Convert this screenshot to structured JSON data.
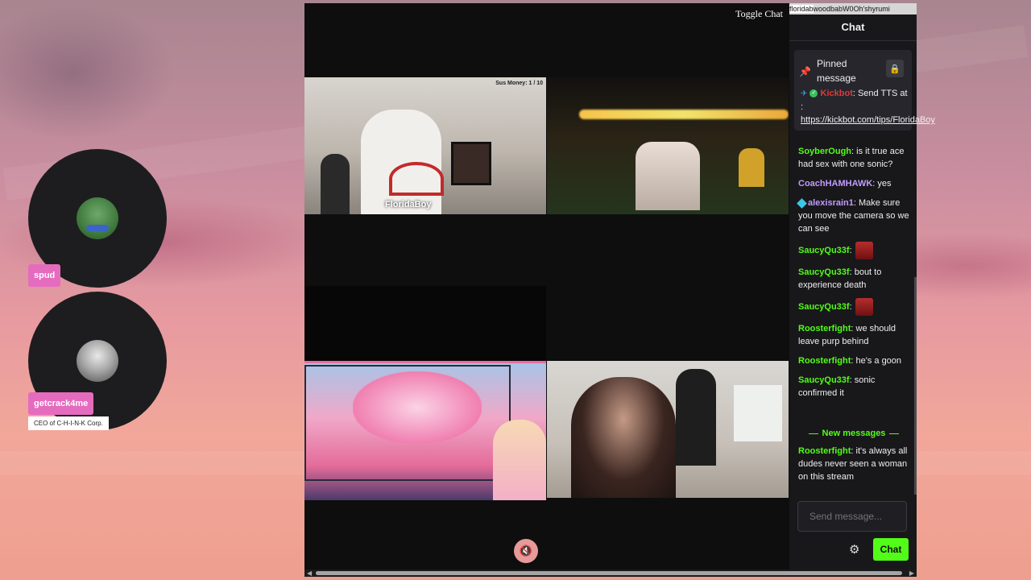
{
  "voice_users": [
    {
      "name": "spud",
      "avatar": "pepe-frog"
    },
    {
      "name": "getcrack4me",
      "subtitle": "CEO of C-H-I-N-K Corp.",
      "avatar": "woman-portrait"
    }
  ],
  "stream": {
    "toggle_chat": "Toggle Chat",
    "tiles": [
      {
        "label": "FloridaBoy",
        "overlay": "Sus Money: 1 / 10"
      },
      {
        "label": ""
      },
      {
        "label": ""
      },
      {
        "label": ""
      }
    ]
  },
  "url_strip": {
    "selected": "floridab",
    "rest": "woodbabW0Oh'shyrumi"
  },
  "chat": {
    "title": "Chat",
    "pinned": {
      "title": "Pinned message",
      "user": "Kickbot",
      "text": ": Send TTS at : ",
      "link": "https://kickbot.com/tips/FloridaBoy"
    },
    "messages": [
      {
        "user": "SoyberOugh",
        "color": "#53fc18",
        "text": ": is it true ace had sex with one sonic?"
      },
      {
        "user": "CoachHAMHAWK",
        "color": "#c29bff",
        "text": ": yes"
      },
      {
        "user": "alexisrain1",
        "color": "#c29bff",
        "text": ": Make sure you move the camera so we can see",
        "badge": "cube"
      },
      {
        "user": "SaucyQu33f",
        "color": "#53fc18",
        "text": ":",
        "emote": true
      },
      {
        "user": "SaucyQu33f",
        "color": "#53fc18",
        "text": ": bout to experience death"
      },
      {
        "user": "SaucyQu33f",
        "color": "#53fc18",
        "text": ":",
        "emote": true
      },
      {
        "user": "Roosterfight",
        "color": "#53fc18",
        "text": ": we should leave purp behind"
      },
      {
        "user": "Roosterfight",
        "color": "#53fc18",
        "text": ": he's a goon"
      },
      {
        "user": "SaucyQu33f",
        "color": "#53fc18",
        "text": ": sonic confirmed it"
      }
    ],
    "new_messages_label": "New messages",
    "after_messages": [
      {
        "user": "Roosterfight",
        "color": "#53fc18",
        "text": ": it's always all dudes never seen a woman on this stream"
      }
    ],
    "send_placeholder": "Send message...",
    "send_button": "Chat"
  }
}
